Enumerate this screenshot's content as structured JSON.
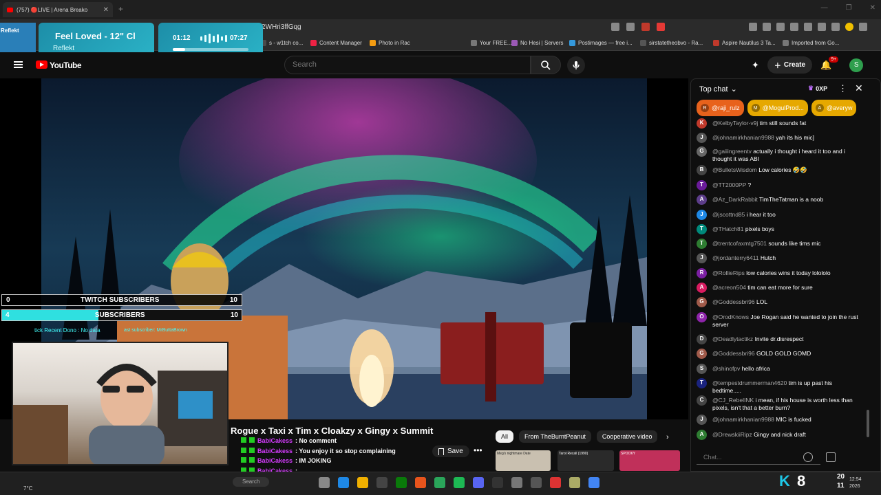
{
  "browser": {
    "tab_title": "(757) 🔴LIVE | Arena Breako",
    "tab_close": "✕",
    "new_tab": "+",
    "window_controls": [
      "—",
      "❐",
      "✕"
    ],
    "url": "2WHri3ffGqg",
    "bookmarks": [
      {
        "label": "s - w1tch co...",
        "color": "#4a4a4a"
      },
      {
        "label": "Content Manager",
        "color": "#e24"
      },
      {
        "label": "Photo in Rac",
        "color": "#f39c12"
      },
      {
        "label": "Your FREE...",
        "color": "#777"
      },
      {
        "label": "No Hesi | Servers",
        "color": "#9b59b6"
      },
      {
        "label": "Postimages — free i...",
        "color": "#3498db"
      },
      {
        "label": "sirstatetheobvo - Ra...",
        "color": "#555"
      },
      {
        "label": "Aspire Nautilus 3 Ta...",
        "color": "#c0392b"
      },
      {
        "label": "Imported from Go...",
        "color": "#777"
      }
    ]
  },
  "music": {
    "side_label": "Reflekt",
    "title": "Feel Loved - 12\" Cl",
    "artist": "Reflekt",
    "elapsed": "01:12",
    "total": "07:27",
    "progress": 0.16
  },
  "youtube": {
    "logo_text": "YouTube",
    "search_placeholder": "Search",
    "create_label": "Create",
    "notif_count": "9+",
    "avatar_letter": "S"
  },
  "overlay": {
    "twitch_left": "0",
    "twitch_label": "TWITCH SUBSCRIBERS",
    "twitch_right": "10",
    "sub_left": "4",
    "sub_label": "SUBSCRIBERS",
    "sub_right": "10",
    "recent_dono": "tick Recent Dono : No data",
    "last_sub": "ast subscriber: MrButtaBrown"
  },
  "video": {
    "title": "Rogue x Taxi x Tim x Cloakzy x Gingy x Summit",
    "ticker": [
      {
        "name": "BabiCakess",
        "text": ": No comment"
      },
      {
        "name": "BabiCakess",
        "text": ": You enjoy it so stop complaining"
      },
      {
        "name": "BabiCakess",
        "text": ": IM JOKING"
      },
      {
        "name": "BabiCakess",
        "text": ": "
      },
      {
        "name": "BabiCakess",
        "text": ": "
      },
      {
        "name": "BabiCakess",
        "text": ": "
      }
    ],
    "save_label": "Save",
    "more_label": "•••",
    "chips": [
      {
        "label": "All",
        "active": true
      },
      {
        "label": "From TheBurntPeanut",
        "active": false
      },
      {
        "label": "Cooperative video",
        "active": false
      }
    ],
    "chip_next": "›",
    "thumbnails": [
      {
        "label": "Meg's nightmare Date",
        "color": "#c9c0b0"
      },
      {
        "label": "Tarot Recall (1990)",
        "color": "#2a2a2a"
      },
      {
        "label": "SPOOKY",
        "color": "#c0305a"
      }
    ]
  },
  "chat": {
    "header": "Top chat",
    "xp": "0XP",
    "pinned": [
      {
        "name": "@raji_rulz",
        "bg": "#e8621c",
        "initial": "R"
      },
      {
        "name": "@MogulProd...",
        "bg": "#e6a800",
        "initial": "M"
      },
      {
        "name": "@averyw",
        "bg": "#e6a800",
        "initial": "A"
      }
    ],
    "messages": [
      {
        "author": "@KelbyTaylor-v9j",
        "text": "tim still sounds fat",
        "color": "#c0392b",
        "initial": "K"
      },
      {
        "author": "@johnamirkhanian9988",
        "text": "yah its his mic]",
        "color": "#555",
        "initial": "J"
      },
      {
        "author": "@gaiiingreentv",
        "text": "actually i thought i heard it too and i thought it was ABI",
        "color": "#666",
        "initial": "G"
      },
      {
        "author": "@BulletsWisdom",
        "text": "Low calories 🤣🤣",
        "color": "#444",
        "initial": "B"
      },
      {
        "author": "@TT2000PP",
        "text": "?",
        "color": "#6a1b9a",
        "initial": "T"
      },
      {
        "author": "@Az_DarkRabbit",
        "text": "TimTheTatman is a noob",
        "color": "#5c3d8a",
        "initial": "A"
      },
      {
        "author": "@jscottnd85",
        "text": "i hear it too",
        "color": "#1e88e5",
        "initial": "J"
      },
      {
        "author": "@THatch81",
        "text": "pixels boys",
        "color": "#00897b",
        "initial": "T"
      },
      {
        "author": "@trentcofaxmtg7501",
        "text": "sounds like tims mic",
        "color": "#2e7d32",
        "initial": "T"
      },
      {
        "author": "@jordanterry6411",
        "text": "Hutch",
        "color": "#555",
        "initial": "J"
      },
      {
        "author": "@RollieRips",
        "text": "low calories wins it today lolololo",
        "color": "#7b1fa2",
        "initial": "R"
      },
      {
        "author": "@acreon504",
        "text": "tim can eat more for sure",
        "color": "#d81b60",
        "initial": "A"
      },
      {
        "author": "@Goddessbri96",
        "text": "LOL",
        "color": "#a05a4a",
        "initial": "G"
      },
      {
        "author": "@OrodKnows",
        "text": "Joe Rogan said he wanted to join the rust server",
        "color": "#8e24aa",
        "initial": "O"
      },
      {
        "author": "@Deadlytactikz",
        "text": "Invite dr.disrespect",
        "color": "#444",
        "initial": "D"
      },
      {
        "author": "@Goddessbri96",
        "text": "GOLD GOLD GOMD",
        "color": "#a05a4a",
        "initial": "G"
      },
      {
        "author": "@shinofpv",
        "text": "hello africa",
        "color": "#555",
        "initial": "S"
      },
      {
        "author": "@tempestdrummerman4620",
        "text": "tim is up past his bedtime.....",
        "color": "#1a237e",
        "initial": "T"
      },
      {
        "author": "@CJ_RebelINK",
        "text": "i mean, if his house is worth less than pixels, isn't that a better burn?",
        "color": "#444",
        "initial": "C"
      },
      {
        "author": "@johnamirkhanian9988",
        "text": "MIC is fucked",
        "color": "#555",
        "initial": "J"
      },
      {
        "author": "@DrewskiiRipz",
        "text": "Gingy and nick draft",
        "color": "#2e7d32",
        "initial": "A"
      }
    ],
    "input_placeholder": "Chat..."
  },
  "taskbar": {
    "weather_temp": "7°C",
    "search_label": "Search",
    "tray_k": "K",
    "tray_num": "8",
    "tray_20": "20",
    "tray_11": "11",
    "clock_time": "12:54",
    "clock_date": "2026",
    "apps": [
      "#888",
      "#1e88e5",
      "#f0b000",
      "#444",
      "#0a7a0a",
      "#e8541c",
      "#2aa55a",
      "#1db954",
      "#5865f2",
      "#333",
      "#777",
      "#555",
      "#d33",
      "#aa6",
      "#4285f4"
    ]
  }
}
